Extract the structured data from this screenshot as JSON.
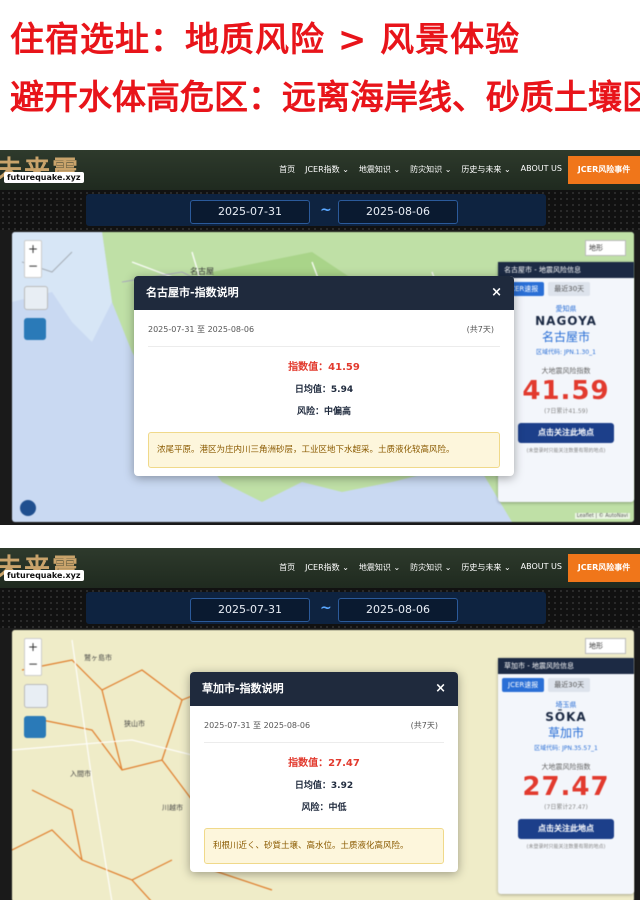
{
  "banner": {
    "line1": "住宿选址：地质风险 > 风景体验",
    "line2": "避开水体高危区：远离海岸线、砂质土壤区"
  },
  "nav": {
    "logo_text": "未来震見",
    "logo_tag": "futurequake.xyz",
    "menu": [
      "首页",
      "JCER指数 ⌄",
      "地震知识 ⌄",
      "防灾知识 ⌄",
      "历史与未来 ⌄",
      "ABOUT US"
    ],
    "risk_button": "JCER风险事件"
  },
  "colors": {
    "accent_red": "#e23a2e",
    "nav_orange": "#f0761a",
    "header_navy": "#1f2a3d",
    "cta_blue": "#1c3f8a"
  },
  "screens": [
    {
      "date_from": "2025-07-31",
      "date_to": "2025-08-06",
      "tilde": "~",
      "map_select": "地形",
      "map_labels": [
        "名古屋"
      ],
      "panel": {
        "header": "名古屋市 - 地震风险信息",
        "tab1": "JCER速报",
        "tab2": "最近30天",
        "pref": "愛知県",
        "en": "NAGOYA",
        "ja": "名古屋市",
        "code": "区域代码: JPN.1.30_1",
        "label": "大地震风险指数",
        "value": "41.59",
        "sub": "(7日累计41.59)",
        "cta": "点击关注此地点",
        "note": "(未登录时只能关注数量有限的地点)"
      },
      "modal": {
        "title": "名古屋市-指数说明",
        "close": "×",
        "range": "2025-07-31 至 2025-08-06",
        "days": "(共7天)",
        "index": "指数值：41.59",
        "avg": "日均值：5.94",
        "risk": "风险：中偏高",
        "desc": "浓尾平原。港区为庄内川三角洲砂层，工业区地下水超采。土质液化较高风险。"
      },
      "attribution": "Leaflet | © AutoNavi"
    },
    {
      "date_from": "2025-07-31",
      "date_to": "2025-08-06",
      "tilde": "~",
      "map_select": "地形",
      "map_labels": [
        "鷲ヶ島市",
        "狭山市",
        "入間市",
        "川越市"
      ],
      "panel": {
        "header": "草加市 - 地震风险信息",
        "tab1": "JCER速报",
        "tab2": "最近30天",
        "pref": "埼玉県",
        "en": "SŌKA",
        "ja": "草加市",
        "code": "区域代码: JPN.35.57_1",
        "label": "大地震风险指数",
        "value": "27.47",
        "sub": "(7日累计27.47)",
        "cta": "点击关注此地点",
        "note": "(未登录时只能关注数量有限的地点)"
      },
      "modal": {
        "title": "草加市-指数说明",
        "close": "×",
        "range": "2025-07-31 至 2025-08-06",
        "days": "(共7天)",
        "index": "指数值：27.47",
        "avg": "日均值：3.92",
        "risk": "风险：中低",
        "desc": "利根川近く、砂質土壌、高水位。土质液化高风险。"
      }
    }
  ]
}
